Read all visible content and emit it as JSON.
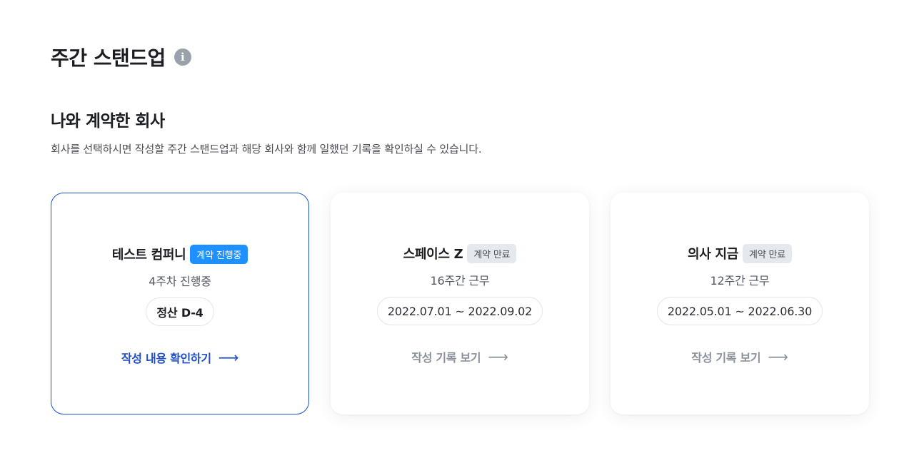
{
  "header": {
    "title": "주간 스탠드업",
    "info_icon": "i"
  },
  "section": {
    "title": "나와 계약한 회사",
    "description": "회사를 선택하시면 작성할 주간 스탠드업과 해당 회사와 함께 일했던 기록을 확인하실 수 있습니다."
  },
  "cards": [
    {
      "company": "테스트 컴퍼니",
      "badge": "계약 진행중",
      "status": "4주차 진행중",
      "pill": "정산 D-4",
      "link": "작성 내용 확인하기",
      "arrow": "⟶"
    },
    {
      "company": "스페이스 Z",
      "badge": "계약 만료",
      "status": "16주간 근무",
      "pill": "2022.07.01 ~ 2022.09.02",
      "link": "작성 기록 보기",
      "arrow": "⟶"
    },
    {
      "company": "의사 지금",
      "badge": "계약 만료",
      "status": "12주간 근무",
      "pill": "2022.05.01 ~ 2022.06.30",
      "link": "작성 기록 보기",
      "arrow": "⟶"
    }
  ],
  "colors": {
    "accent": "#1f4fc8",
    "badge_ongoing": "#1e90ff",
    "badge_ended": "#e5e8ec"
  }
}
